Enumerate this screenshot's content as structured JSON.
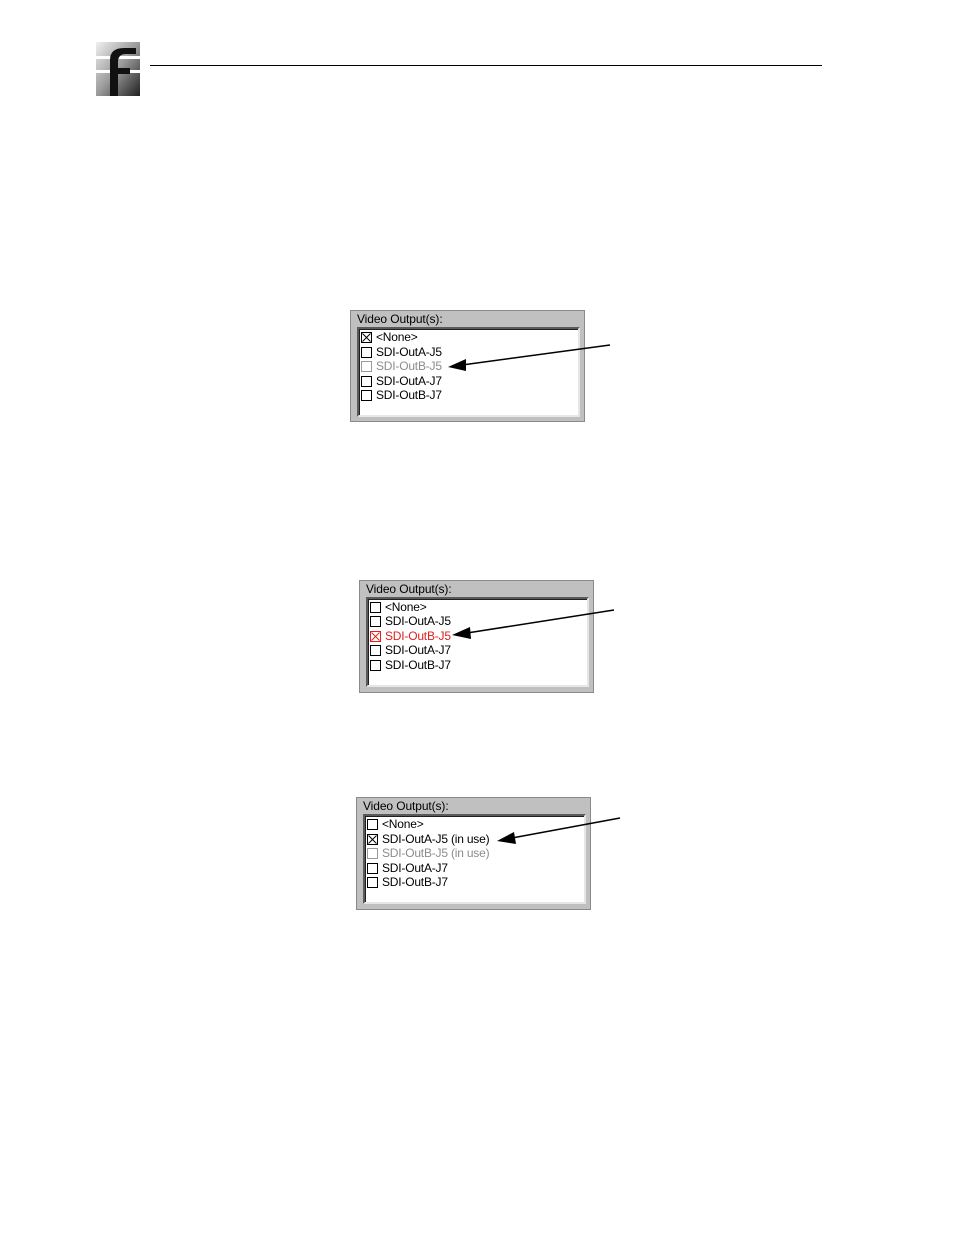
{
  "header": {
    "logo_icon": "company-logo-icon"
  },
  "panels": [
    {
      "label": "Video Output(s):",
      "items": [
        {
          "label": "<None>",
          "checked": true,
          "state": "normal"
        },
        {
          "label": "SDI-OutA-J5",
          "checked": false,
          "state": "normal"
        },
        {
          "label": "SDI-OutB-J5",
          "checked": false,
          "state": "dim"
        },
        {
          "label": "SDI-OutA-J7",
          "checked": false,
          "state": "normal"
        },
        {
          "label": "SDI-OutB-J7",
          "checked": false,
          "state": "normal"
        }
      ]
    },
    {
      "label": "Video Output(s):",
      "items": [
        {
          "label": "<None>",
          "checked": false,
          "state": "normal"
        },
        {
          "label": "SDI-OutA-J5",
          "checked": false,
          "state": "normal"
        },
        {
          "label": "SDI-OutB-J5",
          "checked": true,
          "state": "err"
        },
        {
          "label": "SDI-OutA-J7",
          "checked": false,
          "state": "normal"
        },
        {
          "label": "SDI-OutB-J7",
          "checked": false,
          "state": "normal"
        }
      ]
    },
    {
      "label": "Video Output(s):",
      "items": [
        {
          "label": "<None>",
          "checked": false,
          "state": "normal"
        },
        {
          "label": "SDI-OutA-J5 (in use)",
          "checked": true,
          "state": "normal"
        },
        {
          "label": "SDI-OutB-J5 (in use)",
          "checked": false,
          "state": "dim"
        },
        {
          "label": "SDI-OutA-J7",
          "checked": false,
          "state": "normal"
        },
        {
          "label": "SDI-OutB-J7",
          "checked": false,
          "state": "normal"
        }
      ]
    }
  ],
  "colors": {
    "disabled_text": "#8c8c8c",
    "error_text": "#e02020",
    "dialog_bg": "#c0c0c0"
  }
}
